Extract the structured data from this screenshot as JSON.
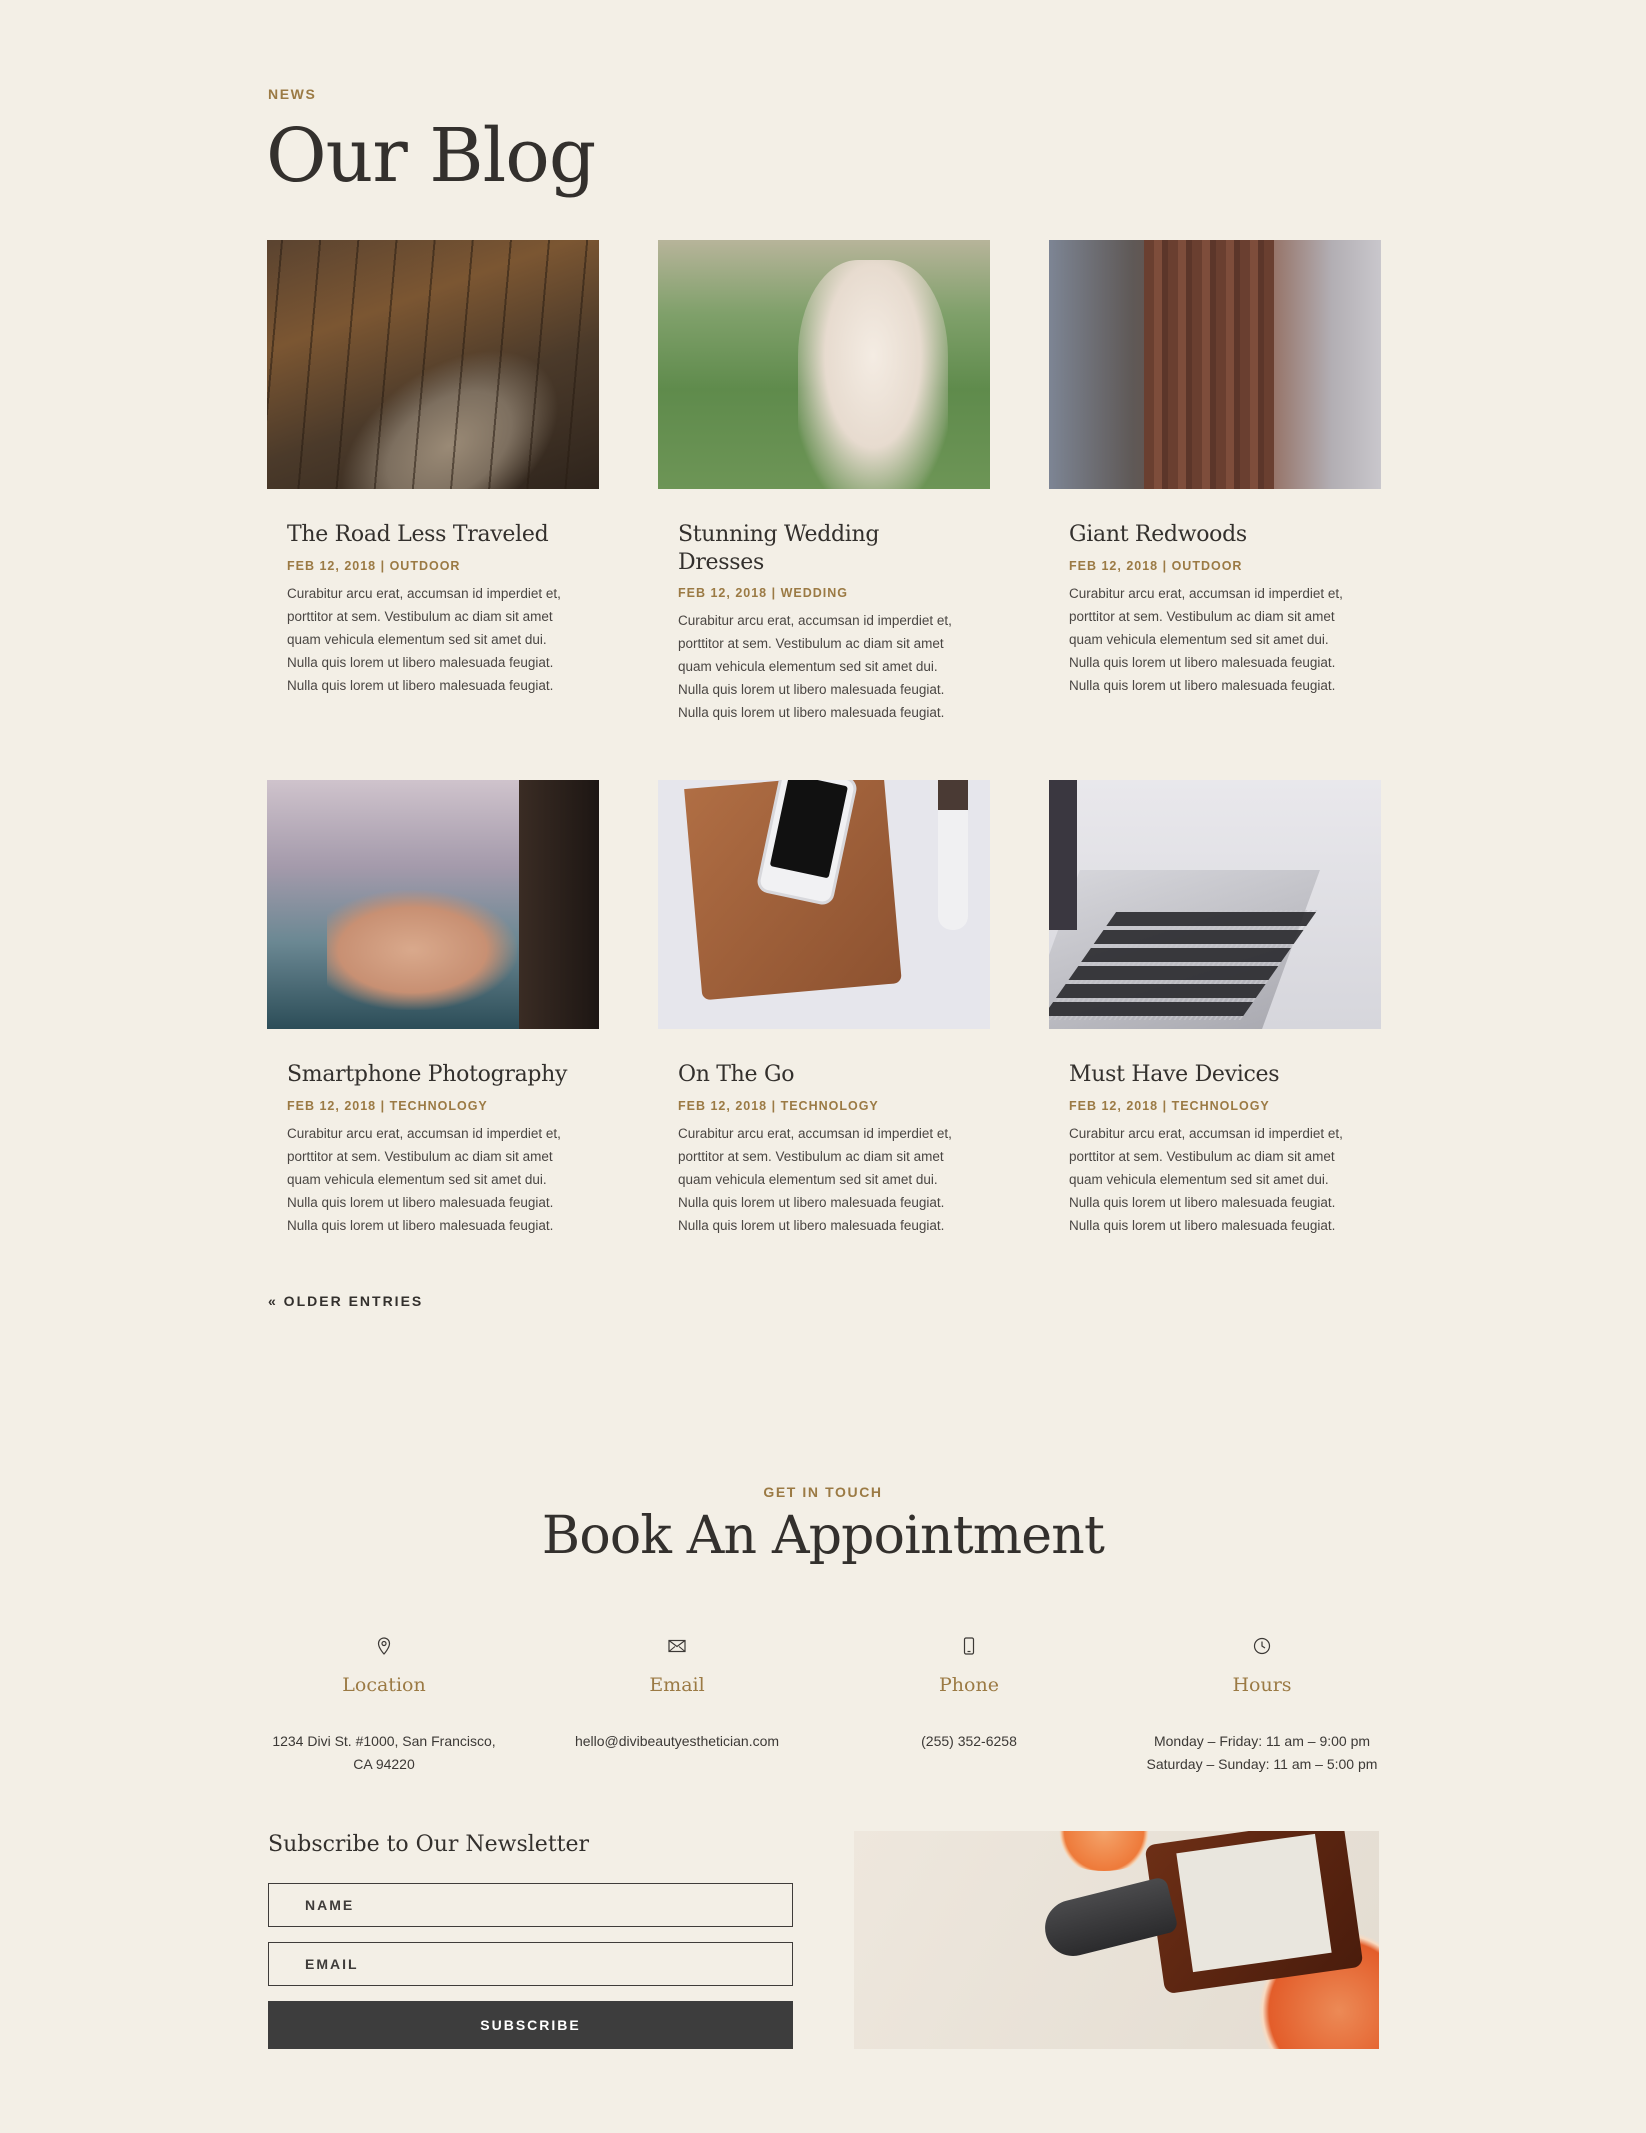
{
  "blog": {
    "eyebrow": "NEWS",
    "title": "Our Blog",
    "posts": [
      {
        "title": "The Road Less Traveled",
        "meta": "FEB 12, 2018 | OUTDOOR",
        "excerpt": "Curabitur arcu erat, accumsan id imperdiet et, porttitor at sem. Vestibulum ac diam sit amet quam vehicula elementum sed sit amet dui. Nulla quis lorem ut libero malesuada feugiat. Nulla quis lorem ut libero malesuada feugiat."
      },
      {
        "title": "Stunning Wedding Dresses",
        "meta": "FEB 12, 2018 | WEDDING",
        "excerpt": "Curabitur arcu erat, accumsan id imperdiet et, porttitor at sem. Vestibulum ac diam sit amet quam vehicula elementum sed sit amet dui. Nulla quis lorem ut libero malesuada feugiat. Nulla quis lorem ut libero malesuada feugiat."
      },
      {
        "title": "Giant Redwoods",
        "meta": "FEB 12, 2018 | OUTDOOR",
        "excerpt": "Curabitur arcu erat, accumsan id imperdiet et, porttitor at sem. Vestibulum ac diam sit amet quam vehicula elementum sed sit amet dui. Nulla quis lorem ut libero malesuada feugiat. Nulla quis lorem ut libero malesuada feugiat."
      },
      {
        "title": "Smartphone Photography",
        "meta": "FEB 12, 2018 | TECHNOLOGY",
        "excerpt": "Curabitur arcu erat, accumsan id imperdiet et, porttitor at sem. Vestibulum ac diam sit amet quam vehicula elementum sed sit amet dui. Nulla quis lorem ut libero malesuada feugiat. Nulla quis lorem ut libero malesuada feugiat."
      },
      {
        "title": "On The Go",
        "meta": "FEB 12, 2018 | TECHNOLOGY",
        "excerpt": "Curabitur arcu erat, accumsan id imperdiet et, porttitor at sem. Vestibulum ac diam sit amet quam vehicula elementum sed sit amet dui. Nulla quis lorem ut libero malesuada feugiat. Nulla quis lorem ut libero malesuada feugiat."
      },
      {
        "title": "Must Have Devices",
        "meta": "FEB 12, 2018 | TECHNOLOGY",
        "excerpt": "Curabitur arcu erat, accumsan id imperdiet et, porttitor at sem. Vestibulum ac diam sit amet quam vehicula elementum sed sit amet dui. Nulla quis lorem ut libero malesuada feugiat. Nulla quis lorem ut libero malesuada feugiat."
      }
    ],
    "older_entries": "« OLDER ENTRIES"
  },
  "contact": {
    "eyebrow": "GET IN TOUCH",
    "title": "Book An Appointment",
    "items": [
      {
        "icon": "location-pin-icon",
        "label": "Location",
        "lines": [
          "1234 Divi St. #1000, San Francisco,",
          "CA 94220"
        ]
      },
      {
        "icon": "envelope-icon",
        "label": "Email",
        "lines": [
          "hello@divibeautyesthetician.com"
        ]
      },
      {
        "icon": "mobile-phone-icon",
        "label": "Phone",
        "lines": [
          "(255) 352-6258"
        ]
      },
      {
        "icon": "clock-icon",
        "label": "Hours",
        "lines": [
          "Monday – Friday: 11 am – 9:00 pm",
          "Saturday – Sunday: 11 am – 5:00 pm"
        ]
      }
    ]
  },
  "newsletter": {
    "title": "Subscribe to Our Newsletter",
    "name_placeholder": "NAME",
    "email_placeholder": "EMAIL",
    "button_label": "SUBSCRIBE"
  },
  "colors": {
    "background": "#f3efe6",
    "accent": "#9b7a44",
    "heading": "#33302d",
    "button": "#3d3d3d"
  }
}
